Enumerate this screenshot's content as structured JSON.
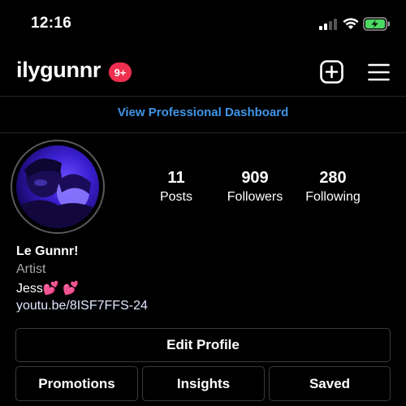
{
  "status_bar": {
    "time": "12:16"
  },
  "header": {
    "username": "ilygunnr",
    "notification_badge": "9+"
  },
  "dashboard_link": "View Professional Dashboard",
  "profile": {
    "stats": [
      {
        "value": "11",
        "label": "Posts"
      },
      {
        "value": "909",
        "label": "Followers"
      },
      {
        "value": "280",
        "label": "Following"
      }
    ],
    "name": "Le Gunnr!",
    "category": "Artist",
    "bio": "Jess💕 💕",
    "link": "youtu.be/8ISF7FFS-24"
  },
  "buttons": {
    "edit_profile": "Edit Profile",
    "promotions": "Promotions",
    "insights": "Insights",
    "saved": "Saved"
  },
  "colors": {
    "background": "#000000",
    "link_blue": "#3f96e8",
    "badge_red": "#ef2f4f",
    "battery_green": "#4cd964"
  }
}
